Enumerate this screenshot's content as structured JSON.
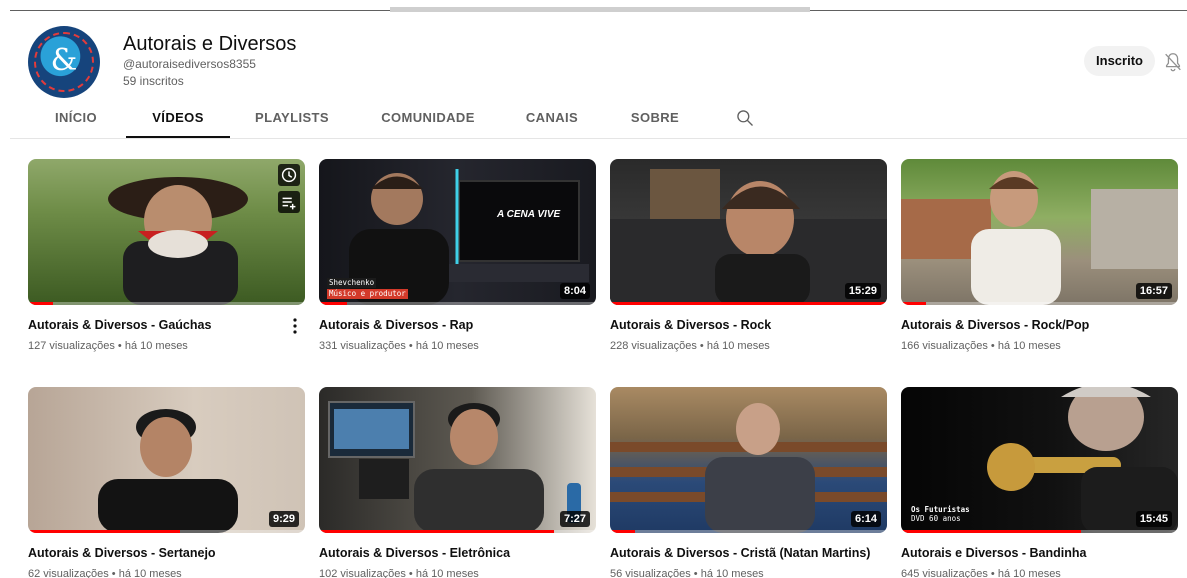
{
  "channel": {
    "name": "Autorais e Diversos",
    "handle": "@autoraisediversos8355",
    "subscribers": "59 inscritos",
    "subscribe_label": "Inscrito",
    "brand_color": "#16447c",
    "accent_color": "#e23b3b"
  },
  "icons": {
    "bell": "bell-off-icon",
    "search": "search-icon",
    "more": "more-vert-icon",
    "watch_later": "clock-icon",
    "add_to_queue": "queue-icon"
  },
  "tabs": [
    {
      "label": "INÍCIO",
      "active": false
    },
    {
      "label": "VÍDEOS",
      "active": true
    },
    {
      "label": "PLAYLISTS",
      "active": false
    },
    {
      "label": "COMUNIDADE",
      "active": false
    },
    {
      "label": "CANAIS",
      "active": false
    },
    {
      "label": "SOBRE",
      "active": false
    }
  ],
  "videos": [
    {
      "title": "Autorais & Diversos - Gaúchas",
      "views": "127 visualizações",
      "age": "há 10 meses",
      "duration": "",
      "watched": 0.09
    },
    {
      "title": "Autorais & Diversos - Rap",
      "views": "331 visualizações",
      "age": "há 10 meses",
      "duration": "8:04",
      "watched": 0.1,
      "caption_name": "Shevchenko",
      "caption_role": "Músico e produtor"
    },
    {
      "title": "Autorais & Diversos - Rock",
      "views": "228 visualizações",
      "age": "há 10 meses",
      "duration": "15:29",
      "watched": 1.0
    },
    {
      "title": "Autorais & Diversos - Rock/Pop",
      "views": "166 visualizações",
      "age": "há 10 meses",
      "duration": "16:57",
      "watched": 0.09
    },
    {
      "title": "Autorais & Diversos - Sertanejo",
      "views": "62 visualizações",
      "age": "há 10 meses",
      "duration": "9:29",
      "watched": 0.55
    },
    {
      "title": "Autorais & Diversos - Eletrônica",
      "views": "102 visualizações",
      "age": "há 10 meses",
      "duration": "7:27",
      "watched": 0.85
    },
    {
      "title": "Autorais & Diversos - Cristã (Natan Martins)",
      "views": "56 visualizações",
      "age": "há 10 meses",
      "duration": "6:14",
      "watched": 0.09
    },
    {
      "title": "Autorais e Diversos - Bandinha",
      "views": "645 visualizações",
      "age": "há 10 meses",
      "duration": "15:45",
      "watched": 0.65,
      "caption_name": "Os Futuristas",
      "caption_role": "DVD 60 anos"
    }
  ],
  "meta_separator": "•",
  "thumb_overlay_text": "A CENA VIVE"
}
